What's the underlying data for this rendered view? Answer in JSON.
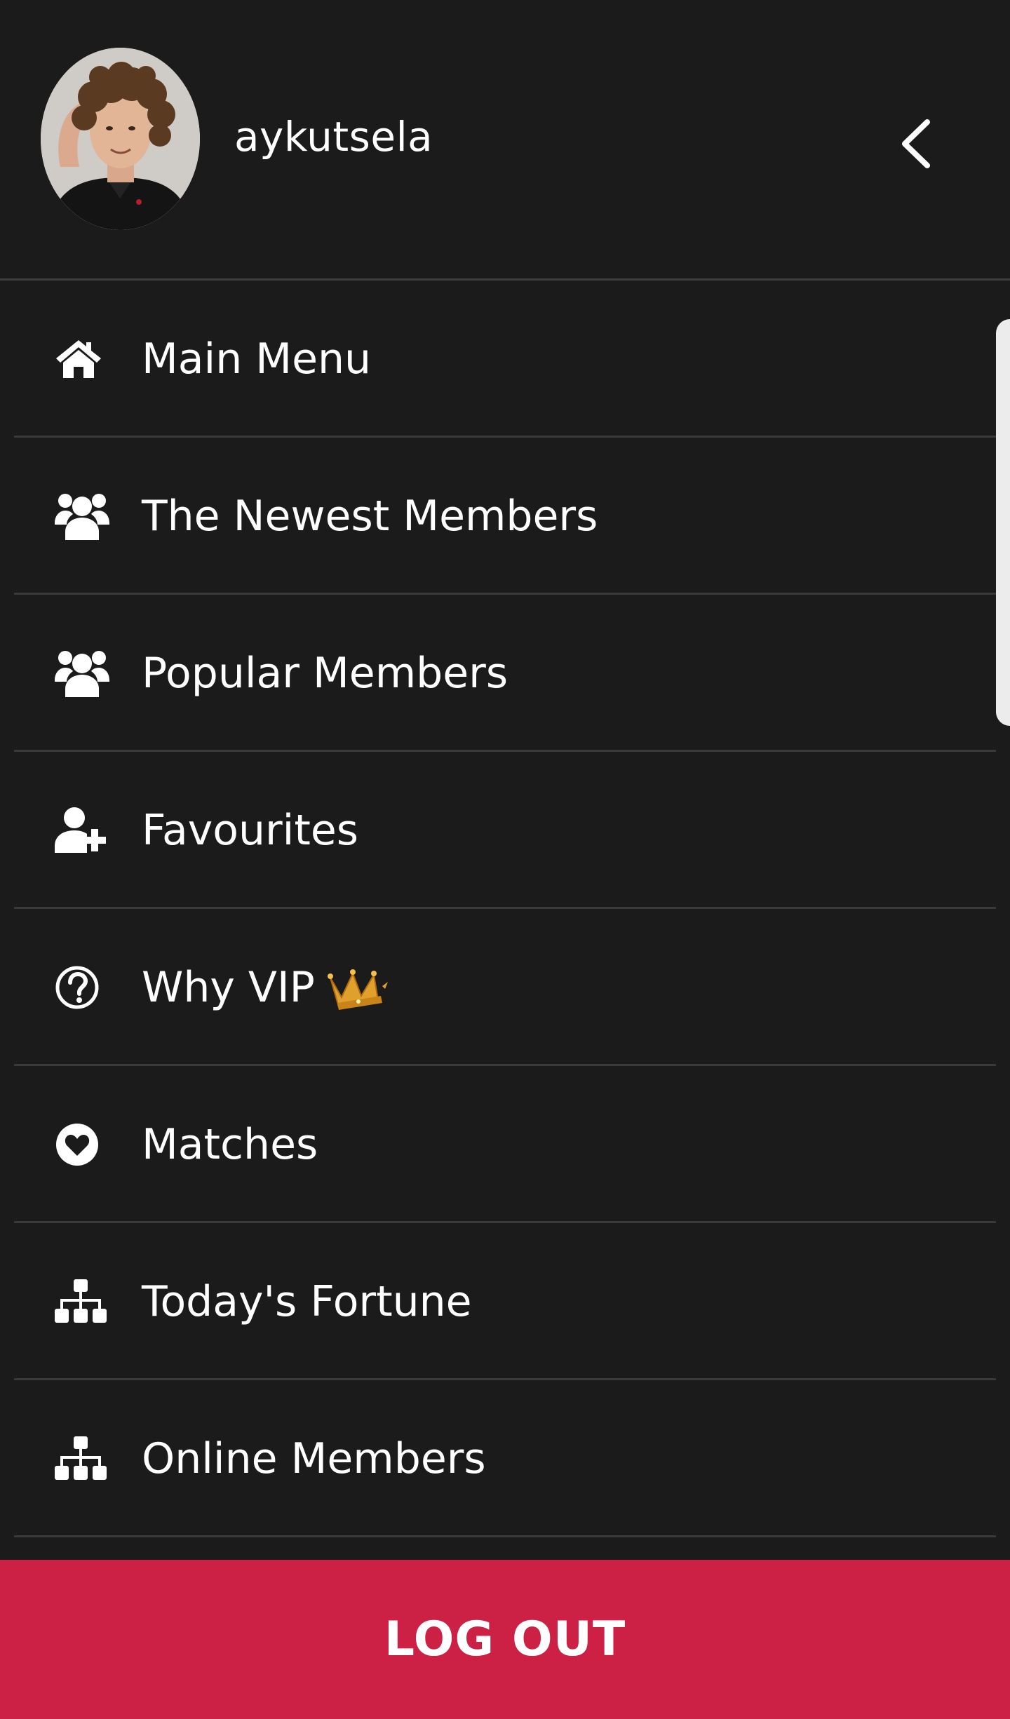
{
  "header": {
    "username": "aykutsela",
    "avatar_icon": "profile-photo",
    "back_icon": "chevron-left-icon"
  },
  "menu": {
    "items": [
      {
        "label": "Main Menu",
        "icon": "home-icon"
      },
      {
        "label": "The Newest Members",
        "icon": "users-icon"
      },
      {
        "label": "Popular Members",
        "icon": "users-icon"
      },
      {
        "label": "Favourites",
        "icon": "user-plus-icon"
      },
      {
        "label": "Why VIP",
        "icon": "question-circle-icon",
        "badge_icon": "crown-icon"
      },
      {
        "label": "Matches",
        "icon": "heart-circle-icon"
      },
      {
        "label": "Today's Fortune",
        "icon": "sitemap-icon"
      },
      {
        "label": "Online Members",
        "icon": "sitemap-icon"
      }
    ]
  },
  "logout": {
    "label": "LOG OUT"
  },
  "colors": {
    "background": "#1b1b1c",
    "separator": "#3a3a3c",
    "text": "#ffffff",
    "logout_bg": "#cc2045",
    "crown": "#e0a02c"
  }
}
